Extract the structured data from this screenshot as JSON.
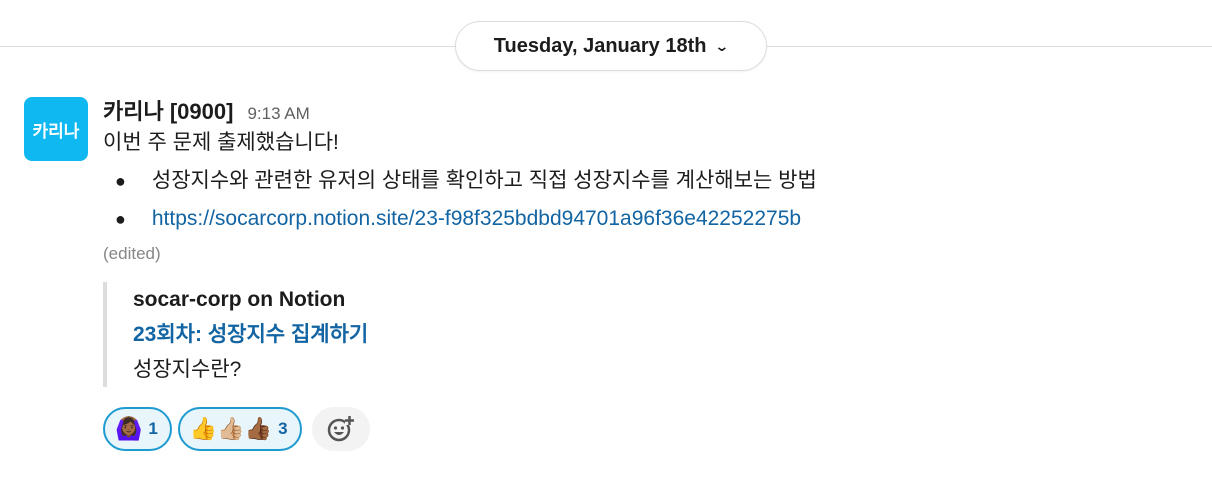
{
  "date_divider": {
    "label": "Tuesday, January 18th",
    "chevron": "⌄"
  },
  "message": {
    "avatar_text": "카리나",
    "author": "카리나 [0900]",
    "time": "9:13 AM",
    "text": "이번 주 문제 출제했습니다!",
    "bullets": [
      {
        "text": "성장지수와 관련한 유저의 상태를 확인하고 직접 성장지수를 계산해보는 방법"
      },
      {
        "text": "https://socarcorp.notion.site/23-f98f325bdbd94701a96f36e42252275b"
      }
    ],
    "edited": "(edited)",
    "attachment": {
      "source": "socar-corp on Notion",
      "title": "23회차: 성장지수 집계하기",
      "description": "성장지수란?"
    },
    "reactions": [
      {
        "emoji": "🙆🏾‍♀️",
        "count": "1"
      },
      {
        "emoji": "👍👍🏼👍🏾",
        "count": "3"
      }
    ],
    "add_reaction_icon": "add-reaction-icon"
  },
  "colors": {
    "link": "#1264a3",
    "avatar": "#0fb8f0",
    "reaction_border": "#1d9bd1"
  }
}
